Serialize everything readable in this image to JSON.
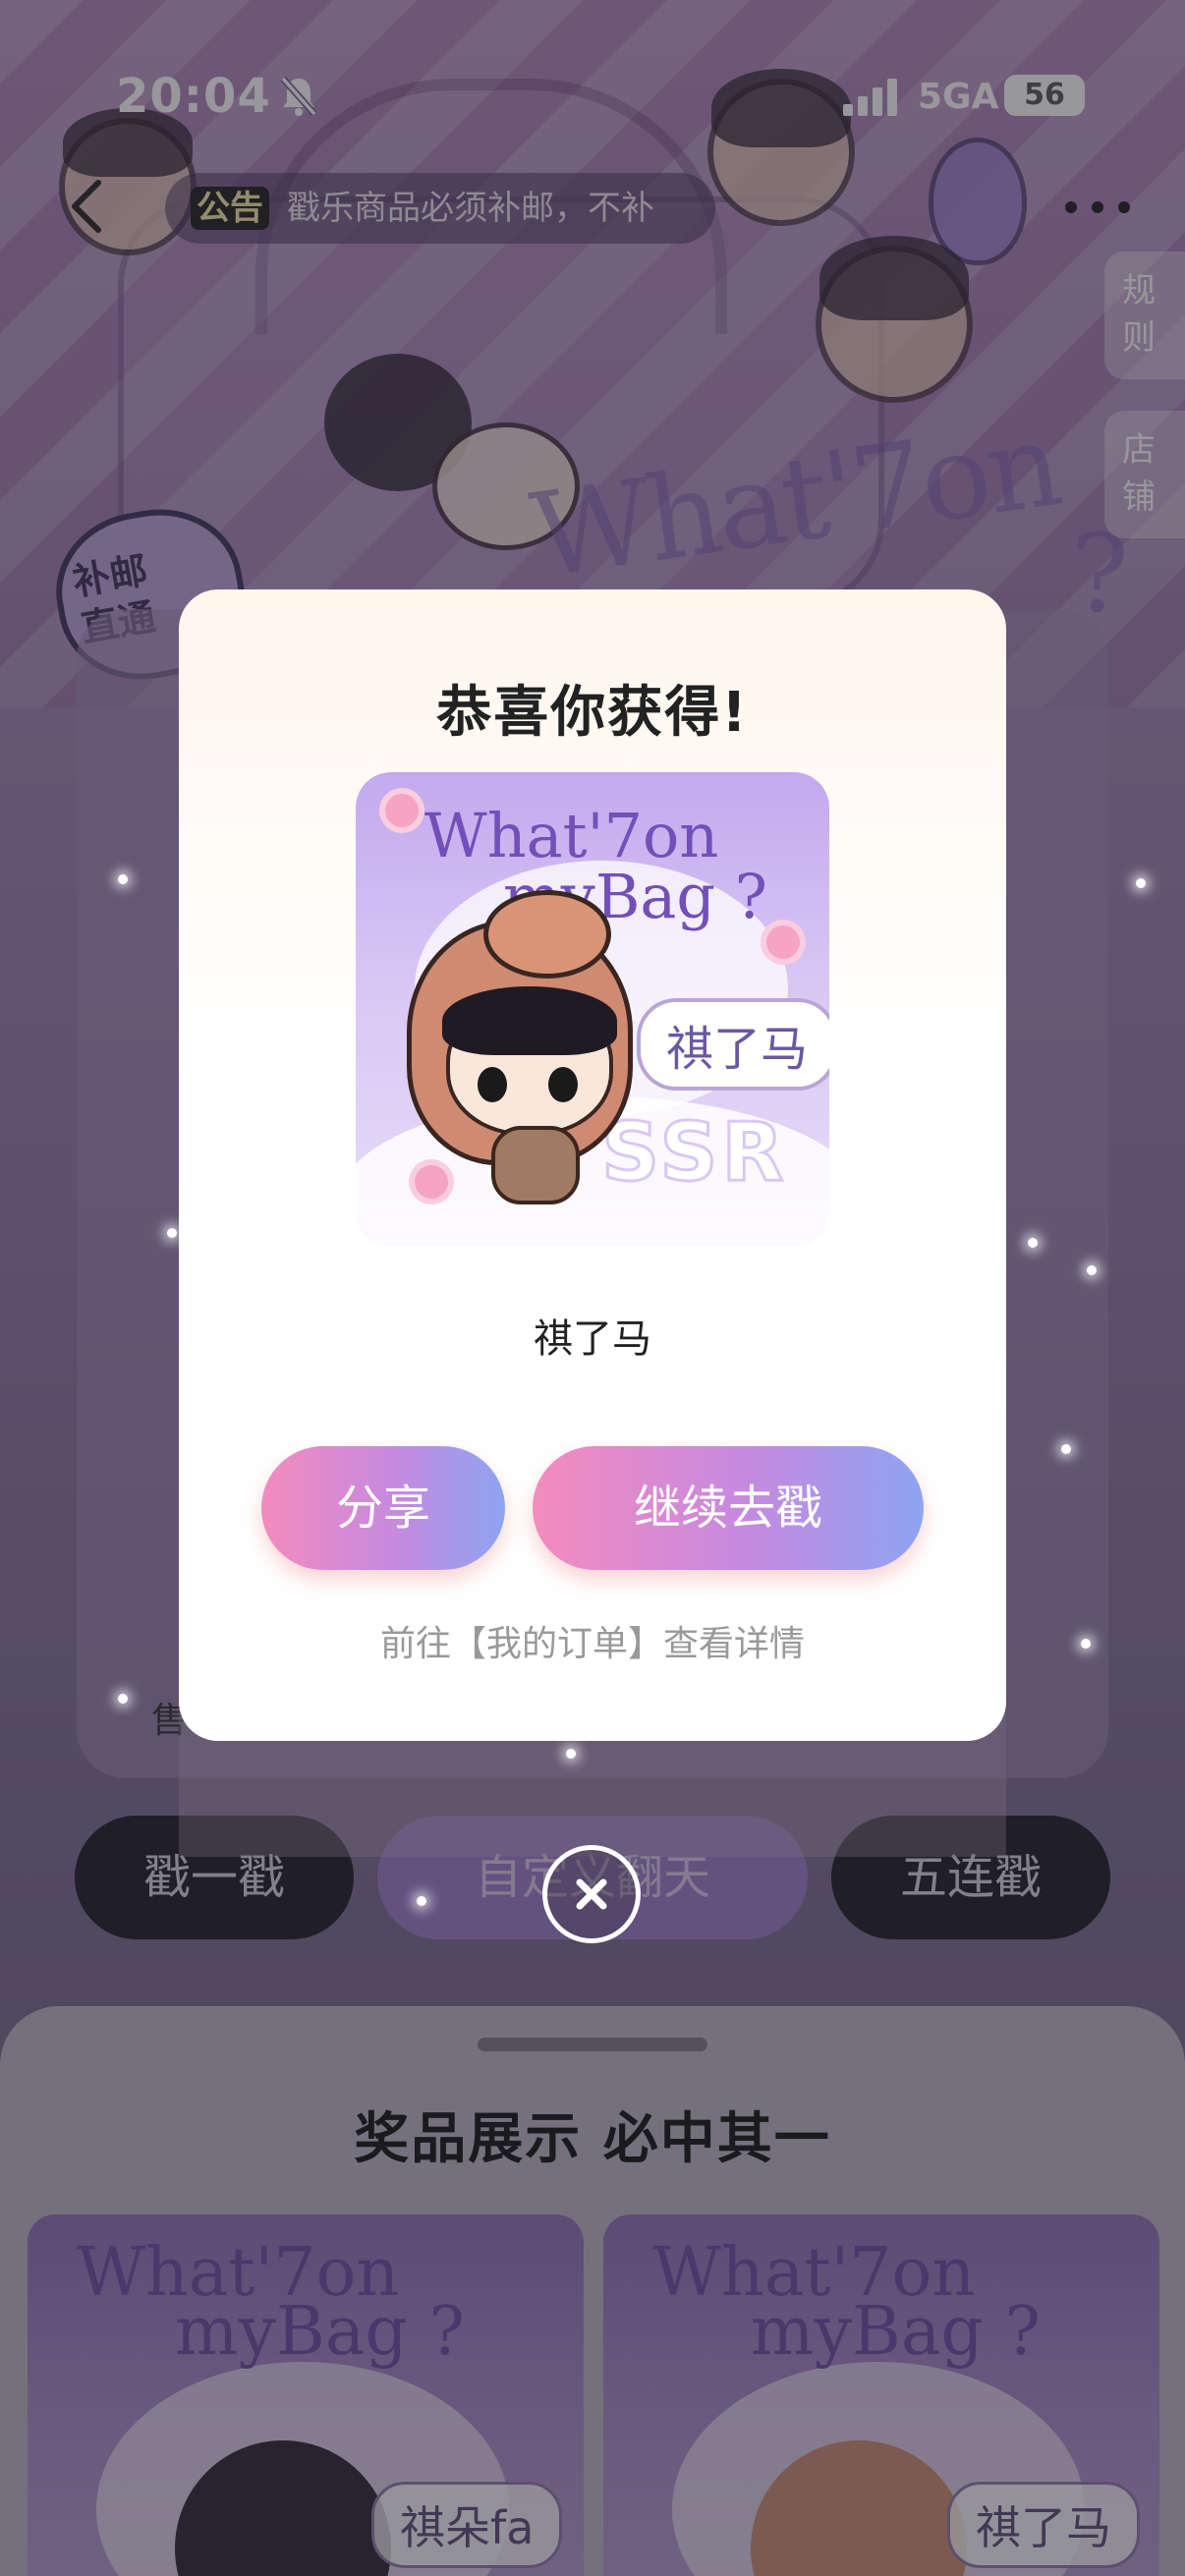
{
  "status_bar": {
    "time": "20:04",
    "network": "5GA",
    "battery": "56",
    "icons": [
      "bell-off-icon",
      "signal-icon"
    ]
  },
  "nav": {
    "notice_tag": "公告",
    "notice_text": "戳乐商品必须补邮，不补",
    "rules_tab": "规则",
    "shop_tab": "店铺"
  },
  "background": {
    "hero_word": "What'7on",
    "hero_question_mark": "?",
    "badge_text": "补邮直通",
    "sale_text": "售",
    "buttons": {
      "once": "戳一戳",
      "custom": "自定义翻天",
      "five": "五连戳"
    },
    "prize_section_title": "奖品展示 必中其一",
    "prize_cards": [
      {
        "line1": "What'7on",
        "line2": "myBag ?",
        "label": "祺朵fa"
      },
      {
        "line1": "What'7on",
        "line2": "myBag ?",
        "label": "祺了马"
      }
    ]
  },
  "modal": {
    "title": "恭喜你获得!",
    "image": {
      "line1": "What'7on",
      "line2": "myBag ?",
      "bubble": "祺了马",
      "rarity": "SSR"
    },
    "prize_name": "祺了马",
    "share_button": "分享",
    "continue_button": "继续去戳",
    "order_link": "前往【我的订单】查看详情"
  },
  "colors": {
    "button_gradient_start": "#f48bbd",
    "button_gradient_end": "#8ea4f2",
    "overlay": "#28262e"
  }
}
